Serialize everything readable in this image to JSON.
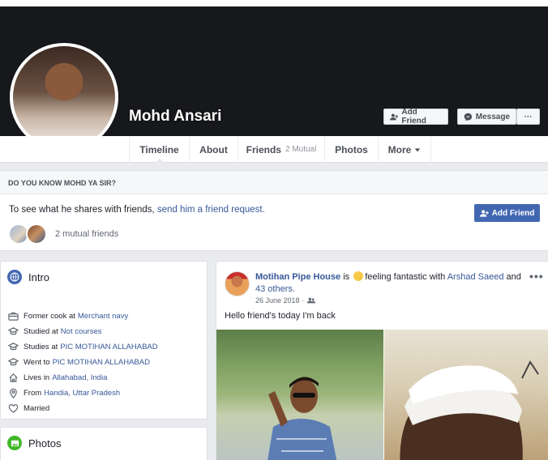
{
  "profile": {
    "name": "Mohd Ansari",
    "add_friend_label": "Add Friend",
    "message_label": "Message",
    "more_label": "···"
  },
  "nav": {
    "timeline": "Timeline",
    "about": "About",
    "friends": "Friends",
    "friends_mutual": "2 Mutual",
    "photos": "Photos",
    "more": "More"
  },
  "dyk": {
    "heading": "DO YOU KNOW MOHD YA SIR?",
    "text_prefix": "To see what he shares with friends,",
    "link": "send him a friend request.",
    "add_friend_label": "Add Friend",
    "mutual_friends": "2 mutual friends"
  },
  "intro": {
    "title": "Intro",
    "items": [
      {
        "icon": "briefcase-icon",
        "pre": "Former  cook at",
        "link": "Merchant navy"
      },
      {
        "icon": "graduation-cap-icon",
        "pre": "Studied at",
        "link": "Not courses"
      },
      {
        "icon": "graduation-cap-icon",
        "pre": "Studies at",
        "link": "PIC MOTIHAN ALLAHABAD"
      },
      {
        "icon": "graduation-cap-icon",
        "pre": "Went to",
        "link": "PIC MOTIHAN ALLAHABAD"
      },
      {
        "icon": "home-icon",
        "pre": "Lives in",
        "link": "Allahabad, India"
      },
      {
        "icon": "location-pin-icon",
        "pre": "From",
        "link": "Handia, Uttar Pradesh"
      },
      {
        "icon": "heart-icon",
        "pre": "Married",
        "link": ""
      }
    ]
  },
  "photos": {
    "title": "Photos"
  },
  "post": {
    "author": "Motihan Pipe House",
    "is": "is",
    "feeling": "feeling fantastic",
    "with": "with",
    "tagged": "Arshad Saeed",
    "and": "and",
    "others": "43 others.",
    "date": "26 June 2018 ·",
    "menu": "•••",
    "text": "Hello friend's today I'm back"
  },
  "colors": {
    "accent": "#4267b2",
    "link": "#365899",
    "cover": "#17181c",
    "background": "#e9ebee"
  }
}
